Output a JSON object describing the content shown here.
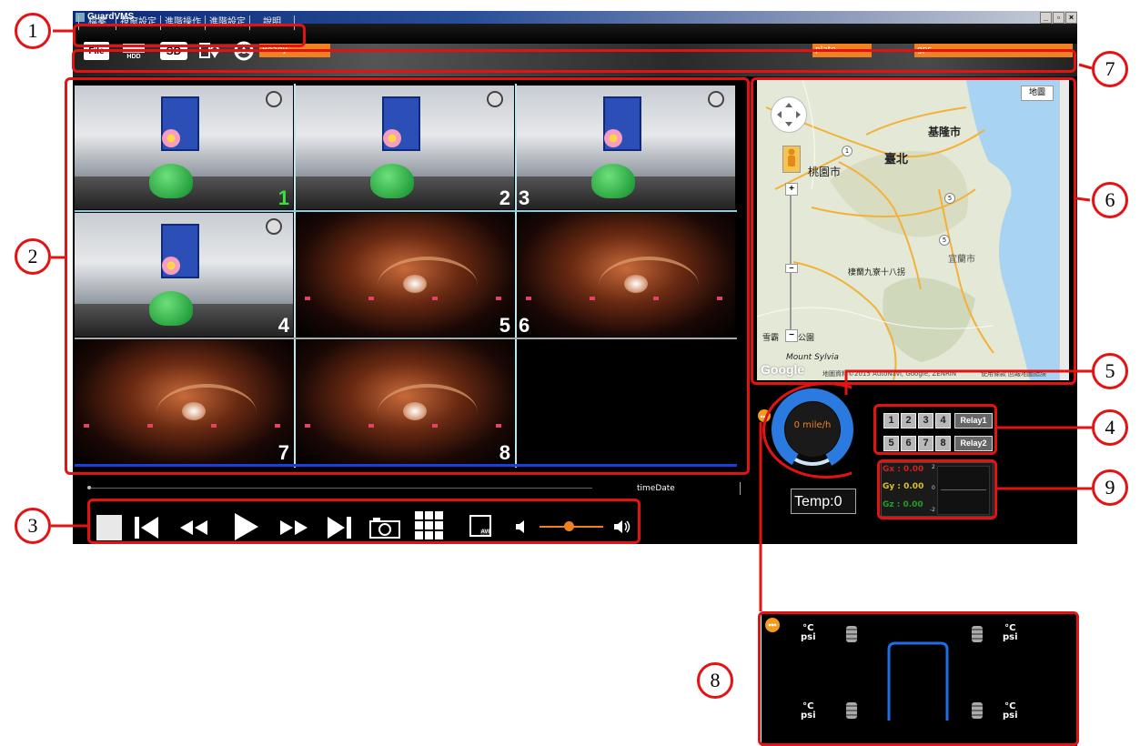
{
  "window": {
    "title": "GuardVMS",
    "min": "_",
    "max": "▫",
    "close": "×"
  },
  "menu": [
    "檔案",
    "視窗設定",
    "進階操作",
    "進階設定",
    "說明"
  ],
  "toolbar": {
    "file": "File",
    "hdd": "HDD",
    "sd": "SD",
    "status": "Ready...",
    "plate": "plate",
    "gps": "gps"
  },
  "cameras": [
    "1",
    "2",
    "3",
    "4",
    "5",
    "6",
    "7",
    "8"
  ],
  "timeline": {
    "time_label": "timeDate"
  },
  "playback": {
    "avi_label": "AVI",
    "volume": 0.45
  },
  "map": {
    "type_button": "地圖",
    "labels": {
      "keelung": "基隆市",
      "taipei": "臺北",
      "taoyuan": "桃園市",
      "yilan": "宜蘭市",
      "park": "棲蘭九寮十八拐",
      "xueba": "雪霸",
      "park2": "公園",
      "sylvia": "Mount Sylvia"
    },
    "road_badges": [
      "1",
      "5",
      "5"
    ],
    "zoom_in": "+",
    "zoom_out": "−",
    "google": "Google",
    "attribution": "地圖資料©2015 AutoNavi, Google, ZENRIN",
    "terms": "使用條款",
    "report": "回報地圖錯誤"
  },
  "speed": {
    "value": "0 mile/h"
  },
  "temp": {
    "value": "Temp:0"
  },
  "relays": {
    "row1": [
      "1",
      "2",
      "3",
      "4"
    ],
    "row2": [
      "5",
      "6",
      "7",
      "8"
    ],
    "relay1": "Relay1",
    "relay2": "Relay2"
  },
  "gsensor": {
    "gx": "Gx : 0.00",
    "gy": "Gy : 0.00",
    "gz": "Gz : 0.00",
    "t_plus": "2",
    "t_zero": "0",
    "t_minus": "-2"
  },
  "tpms": {
    "unit_temp": "°C",
    "unit_psi": "psi"
  },
  "callouts": [
    "1",
    "2",
    "3",
    "4",
    "5",
    "6",
    "7",
    "8",
    "9"
  ],
  "colors": {
    "highlight": "#e31313",
    "orange": "#f08020",
    "gauge_blue": "#2a7ae0",
    "grid_line": "#bfe6f0"
  }
}
